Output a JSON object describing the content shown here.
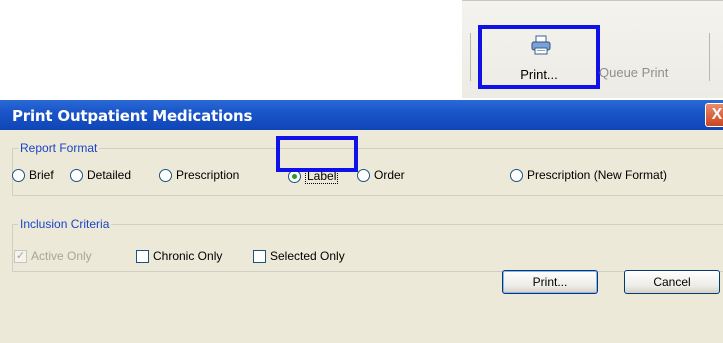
{
  "toolbar": {
    "print_label": "Print...",
    "queue_print_label": "Queue Print",
    "print_icon": "printer-icon"
  },
  "dialog": {
    "title": "Print Outpatient Medications",
    "close_label": "X",
    "report_format": {
      "legend": "Report Format",
      "options": [
        {
          "label": "Brief",
          "checked": false
        },
        {
          "label": "Detailed",
          "checked": false
        },
        {
          "label": "Prescription",
          "checked": false
        },
        {
          "label": "Label",
          "checked": true
        },
        {
          "label": "Order",
          "checked": false
        },
        {
          "label": "Prescription (New Format)",
          "checked": false
        }
      ]
    },
    "inclusion_criteria": {
      "legend": "Inclusion Criteria",
      "options": [
        {
          "label": "Active Only",
          "checked": true,
          "disabled": true
        },
        {
          "label": "Chronic Only",
          "checked": false,
          "disabled": false
        },
        {
          "label": "Selected Only",
          "checked": false,
          "disabled": false
        }
      ]
    },
    "buttons": {
      "print": "Print...",
      "cancel": "Cancel"
    }
  },
  "colors": {
    "highlight": "#1010e8",
    "titlebar": "#1a55c8",
    "legend_text": "#1a45c6",
    "dialog_bg": "#ece9d8"
  }
}
